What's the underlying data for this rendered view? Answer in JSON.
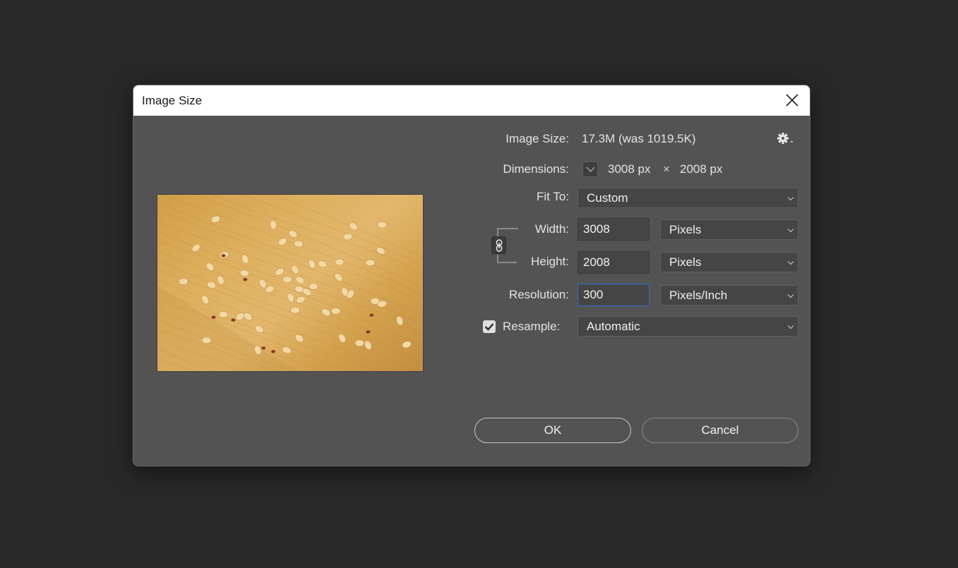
{
  "dialog": {
    "title": "Image Size",
    "close_icon": "close-icon"
  },
  "info": {
    "image_size_label": "Image Size:",
    "image_size_value": "17.3M (was 1019.5K)",
    "settings_icon": "gear-icon",
    "dimensions_label": "Dimensions:",
    "dimensions_width": "3008 px",
    "dimensions_times": "×",
    "dimensions_height": "2008 px"
  },
  "fit_to": {
    "label": "Fit To:",
    "selected": "Custom"
  },
  "width": {
    "label": "Width:",
    "value": "3008",
    "unit": "Pixels"
  },
  "height": {
    "label": "Height:",
    "value": "2008",
    "unit": "Pixels"
  },
  "constrain_proportions": {
    "icon": "link-icon",
    "linked": true
  },
  "resolution": {
    "label": "Resolution:",
    "value": "300",
    "unit": "Pixels/Inch"
  },
  "resample": {
    "label": "Resample:",
    "checked": true,
    "selected": "Automatic"
  },
  "buttons": {
    "ok": "OK",
    "cancel": "Cancel"
  },
  "preview": {
    "description": "Peanuts scattered on a wooden surface"
  },
  "colors": {
    "dialog_bg": "#535353",
    "backdrop": "#282828",
    "focus_border": "#2f6fd0"
  }
}
